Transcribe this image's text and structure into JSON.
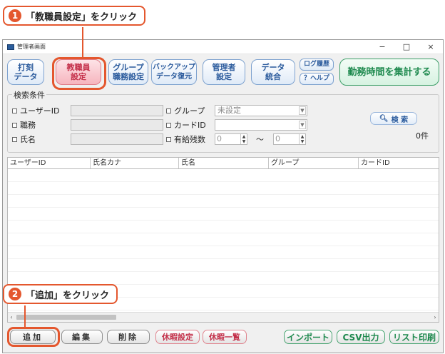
{
  "callouts": [
    {
      "number": "1",
      "text": "「教職員設定」をクリック"
    },
    {
      "number": "2",
      "text": "「追加」をクリック"
    }
  ],
  "window": {
    "title": "管理者画面",
    "controls": {
      "minimize": "−",
      "maximize": "□",
      "close": "×"
    }
  },
  "toolbar": {
    "punch_data": [
      "打刻",
      "データ"
    ],
    "staff_settings": [
      "教職員",
      "設定"
    ],
    "group_settings": [
      "グループ",
      "職務設定"
    ],
    "backup_restore": [
      "バックアップ",
      "データ復元"
    ],
    "admin_settings": [
      "管理者",
      "設定"
    ],
    "data_merge": [
      "データ",
      "統合"
    ],
    "log_history": "ログ履歴",
    "help": "？ヘルプ",
    "aggregate": "勤務時間を集計する"
  },
  "search": {
    "group_label": "検索条件",
    "user_id_label": "ユーザーID",
    "post_label": "職務",
    "name_label": "氏名",
    "group_field_label": "グループ",
    "group_value": "未設定",
    "card_id_label": "カードID",
    "paid_leave_label": "有給残数",
    "paid_leave_from": "0",
    "paid_leave_to": "0",
    "range_sep": "〜",
    "search_button": "検 索",
    "search_icon": "magnifier-icon",
    "result_count": "0件"
  },
  "table": {
    "columns": [
      "ユーザーID",
      "氏名カナ",
      "氏名",
      "グループ",
      "カードID"
    ]
  },
  "bottom": {
    "add": "追加",
    "edit": "編集",
    "delete": "削除",
    "leave_settings": "休暇設定",
    "leave_list": "休暇一覧",
    "import": "インポート",
    "csv_output": "CSV出力",
    "list_print": "リスト印刷"
  },
  "colors": {
    "accent": "#e4572e",
    "toolbar_blue": "#2a5a9c",
    "pink": "#c4304a",
    "green": "#1f8a4f"
  }
}
